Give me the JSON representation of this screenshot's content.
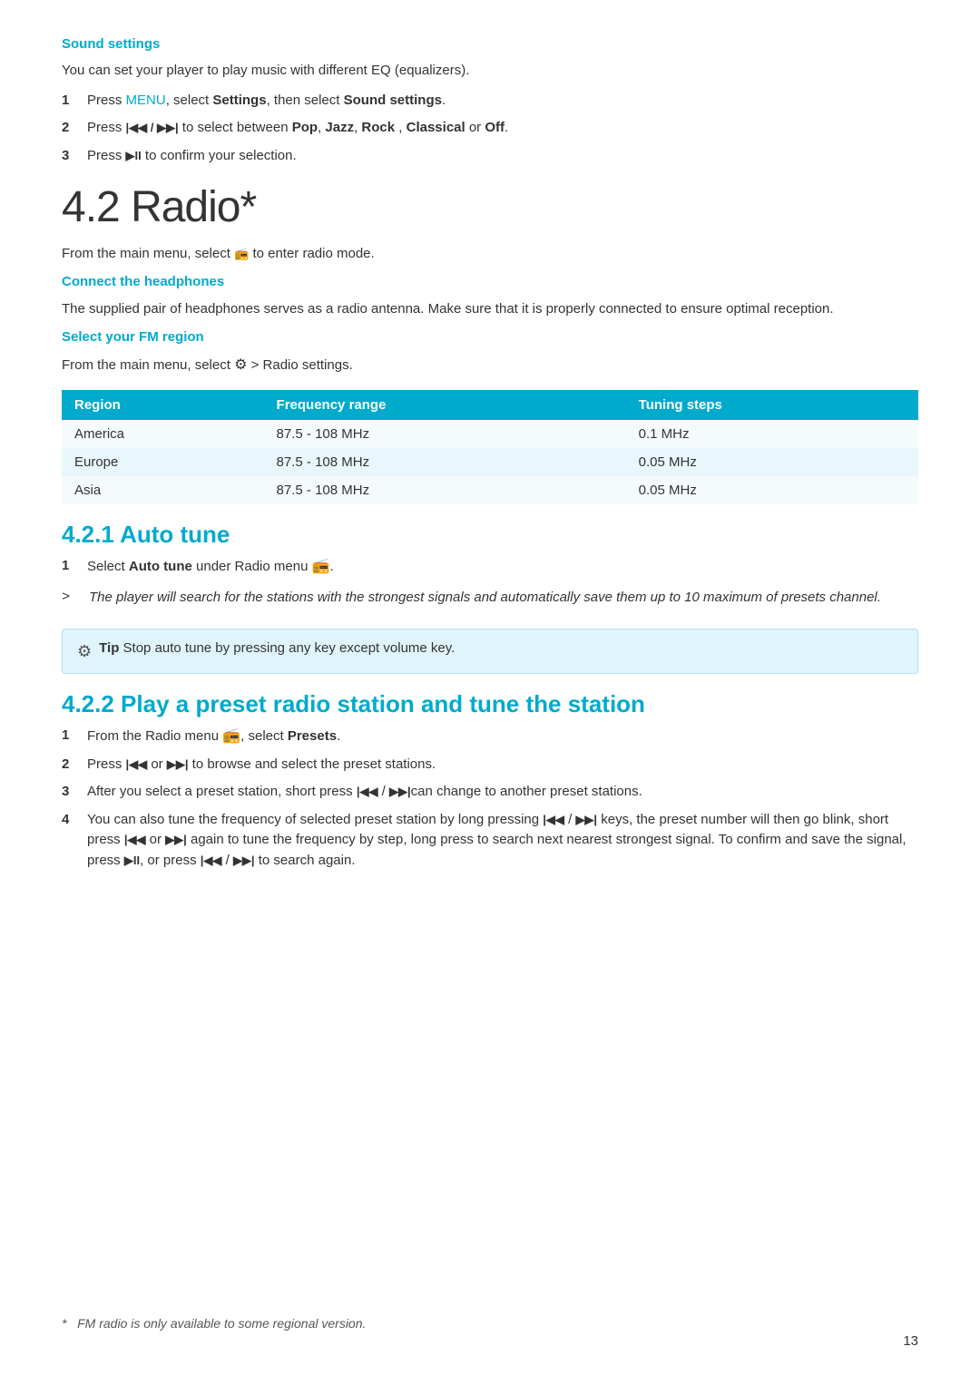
{
  "page": {
    "number": "13"
  },
  "sound_settings": {
    "heading": "Sound settings",
    "intro": "You can set your player to play music with different EQ (equalizers).",
    "steps": [
      {
        "num": "1",
        "text_parts": [
          {
            "type": "text",
            "value": "Press "
          },
          {
            "type": "menu",
            "value": "MENU"
          },
          {
            "type": "text",
            "value": ", select "
          },
          {
            "type": "bold",
            "value": "Settings"
          },
          {
            "type": "text",
            "value": ", then select "
          },
          {
            "type": "bold",
            "value": "Sound settings"
          },
          {
            "type": "text",
            "value": "."
          }
        ]
      },
      {
        "num": "2",
        "text_parts": [
          {
            "type": "text",
            "value": "Press "
          },
          {
            "type": "icon",
            "value": "⏮⏭"
          },
          {
            "type": "text",
            "value": " to select between "
          },
          {
            "type": "bold",
            "value": "Pop"
          },
          {
            "type": "text",
            "value": ", "
          },
          {
            "type": "bold",
            "value": "Jazz"
          },
          {
            "type": "text",
            "value": ", "
          },
          {
            "type": "bold",
            "value": "Rock"
          },
          {
            "type": "text",
            "value": " , "
          },
          {
            "type": "bold",
            "value": "Classical"
          },
          {
            "type": "text",
            "value": " or "
          },
          {
            "type": "bold",
            "value": "Off"
          },
          {
            "type": "text",
            "value": "."
          }
        ]
      },
      {
        "num": "3",
        "text_parts": [
          {
            "type": "text",
            "value": "Press "
          },
          {
            "type": "icon",
            "value": "▶⏸"
          },
          {
            "type": "text",
            "value": " to confirm your selection."
          }
        ]
      }
    ]
  },
  "radio_section": {
    "title": "4.2  Radio*",
    "intro": "From the main menu, select",
    "intro_after": "to enter radio mode."
  },
  "connect_headphones": {
    "heading": "Connect the headphones",
    "body": "The supplied pair of headphones serves as a radio antenna. Make sure that it is properly connected to ensure optimal reception."
  },
  "fm_region": {
    "heading": "Select your FM region",
    "intro": "From the main menu, select",
    "intro_after": "> Radio settings.",
    "table": {
      "headers": [
        "Region",
        "Frequency range",
        "Tuning steps"
      ],
      "rows": [
        [
          "America",
          "87.5 - 108 MHz",
          "0.1 MHz"
        ],
        [
          "Europe",
          "87.5 - 108 MHz",
          "0.05 MHz"
        ],
        [
          "Asia",
          "87.5 - 108 MHz",
          "0.05 MHz"
        ]
      ]
    }
  },
  "auto_tune": {
    "heading": "4.2.1  Auto tune",
    "steps": [
      {
        "num": "1",
        "text": "Select Auto tune under Radio menu"
      }
    ],
    "note": "The player will search for the stations with the strongest signals and automatically save them up to 10 maximum of presets channel.",
    "tip": {
      "label": "Tip",
      "text": "Stop auto tune by pressing any key except volume key."
    }
  },
  "play_preset": {
    "heading": "4.2.2  Play a preset radio station and tune the station",
    "steps": [
      {
        "num": "1",
        "text_before": "From the Radio menu",
        "text_after": ", select",
        "bold": "Presets",
        "end": "."
      },
      {
        "num": "2",
        "text": "Press",
        "icon1": "⏮◀",
        "or": "or",
        "icon2": "▶⏭",
        "text2": "to browse and select the preset stations."
      },
      {
        "num": "3",
        "text": "After you select a preset station, short press",
        "icon1": "⏮◀",
        "sep": "/",
        "icon2": "▶⏭",
        "text2": "can change to another preset stations."
      },
      {
        "num": "4",
        "text": "You can also tune the frequency of selected preset station by long pressing",
        "icon1": "⏮◀",
        "sep": "/",
        "icon2": "▶⏭",
        "text2": "keys, the preset number will then go blink, short press",
        "icon3": "⏮◀",
        "or": "or",
        "icon4": "▶⏭",
        "text3": "again to tune the frequency by step, long press to search next nearest strongest signal. To confirm and save the signal, press",
        "icon5": "▶⏸",
        "text4": ", or press",
        "icon6": "⏮◀",
        "sep2": "/",
        "icon7": "▶⏭",
        "text5": "to search again."
      }
    ]
  },
  "footnote": {
    "symbol": "*",
    "text": "FM radio is only available to some regional version."
  }
}
